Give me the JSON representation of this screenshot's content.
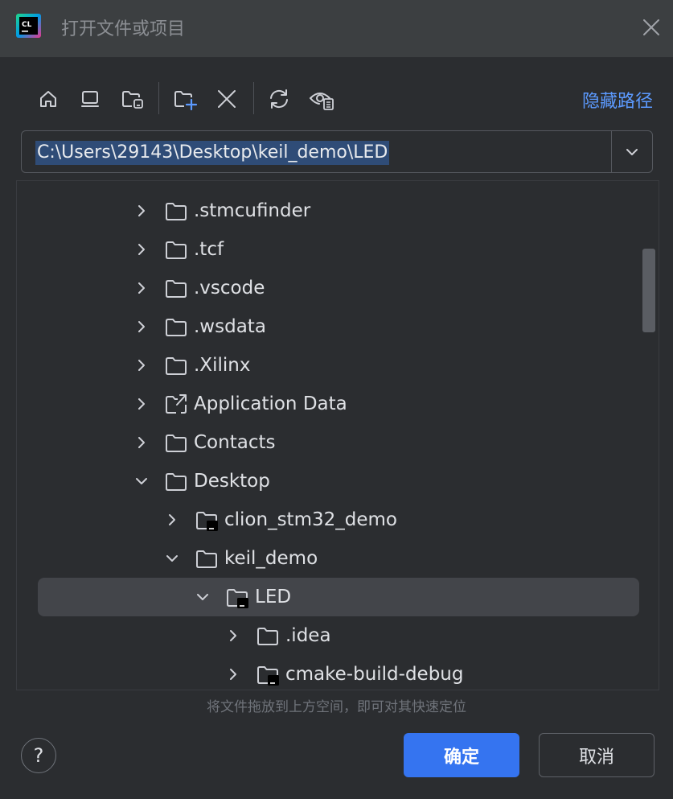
{
  "window": {
    "title": "打开文件或项目",
    "app_icon": "clion-logo-icon",
    "app_icon_text": "CL"
  },
  "toolbar": {
    "buttons": [
      "home-icon",
      "desktop-icon",
      "project-folder-icon",
      "new-folder-icon",
      "delete-icon",
      "refresh-icon",
      "show-hidden-icon"
    ],
    "hide_path_label": "隐藏路径"
  },
  "path": {
    "value": "C:\\Users\\29143\\Desktop\\keil_demo\\LED"
  },
  "tree": {
    "items": [
      {
        "label": ".stmcufinder",
        "level": 0,
        "expanded": false,
        "icon": "folder-icon"
      },
      {
        "label": ".tcf",
        "level": 0,
        "expanded": false,
        "icon": "folder-icon"
      },
      {
        "label": ".vscode",
        "level": 0,
        "expanded": false,
        "icon": "folder-icon"
      },
      {
        "label": ".wsdata",
        "level": 0,
        "expanded": false,
        "icon": "folder-icon"
      },
      {
        "label": ".Xilinx",
        "level": 0,
        "expanded": false,
        "icon": "folder-icon"
      },
      {
        "label": "Application Data",
        "level": 0,
        "expanded": false,
        "icon": "folder-link-icon"
      },
      {
        "label": "Contacts",
        "level": 0,
        "expanded": false,
        "icon": "folder-icon"
      },
      {
        "label": "Desktop",
        "level": 0,
        "expanded": true,
        "icon": "folder-icon"
      },
      {
        "label": "clion_stm32_demo",
        "level": 1,
        "expanded": false,
        "icon": "project-folder-icon"
      },
      {
        "label": "keil_demo",
        "level": 1,
        "expanded": true,
        "icon": "folder-icon"
      },
      {
        "label": "LED",
        "level": 2,
        "expanded": true,
        "icon": "project-folder-icon",
        "selected": true
      },
      {
        "label": ".idea",
        "level": 3,
        "expanded": false,
        "icon": "folder-icon"
      },
      {
        "label": "cmake-build-debug",
        "level": 3,
        "expanded": false,
        "icon": "project-folder-icon"
      }
    ]
  },
  "hint": "将文件拖放到上方空间，即可对其快速定位",
  "footer": {
    "help_label": "?",
    "ok_label": "确定",
    "cancel_label": "取消"
  },
  "colors": {
    "accent": "#3574f0",
    "link": "#5c9aff",
    "selection": "#43454a",
    "path_highlight": "#2f4c77"
  }
}
